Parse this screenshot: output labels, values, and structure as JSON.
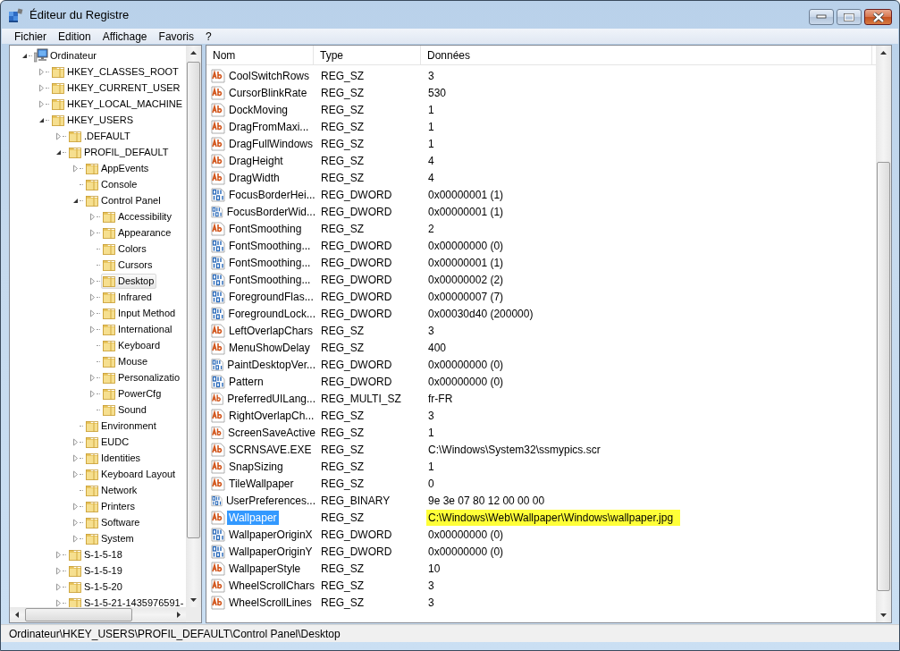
{
  "window": {
    "title": "Éditeur du Registre"
  },
  "menu": [
    "Fichier",
    "Edition",
    "Affichage",
    "Favoris",
    "?"
  ],
  "tree": {
    "label": "Ordinateur",
    "expandable": true,
    "expanded": true,
    "selected": false,
    "children": [
      {
        "label": "HKEY_CLASSES_ROOT",
        "expandable": true,
        "expanded": false,
        "selected": false
      },
      {
        "label": "HKEY_CURRENT_USER",
        "expandable": true,
        "expanded": false,
        "selected": false
      },
      {
        "label": "HKEY_LOCAL_MACHINE",
        "expandable": true,
        "expanded": false,
        "selected": false
      },
      {
        "label": "HKEY_USERS",
        "expandable": true,
        "expanded": true,
        "selected": false,
        "children": [
          {
            "label": ".DEFAULT",
            "expandable": true,
            "expanded": false,
            "selected": false
          },
          {
            "label": "PROFIL_DEFAULT",
            "expandable": true,
            "expanded": true,
            "selected": false,
            "children": [
              {
                "label": "AppEvents",
                "expandable": true,
                "expanded": false,
                "selected": false
              },
              {
                "label": "Console",
                "expandable": false,
                "selected": false
              },
              {
                "label": "Control Panel",
                "expandable": true,
                "expanded": true,
                "selected": false,
                "children": [
                  {
                    "label": "Accessibility",
                    "expandable": true,
                    "expanded": false,
                    "selected": false
                  },
                  {
                    "label": "Appearance",
                    "expandable": true,
                    "expanded": false,
                    "selected": false
                  },
                  {
                    "label": "Colors",
                    "expandable": false,
                    "selected": false
                  },
                  {
                    "label": "Cursors",
                    "expandable": false,
                    "selected": false
                  },
                  {
                    "label": "Desktop",
                    "expandable": true,
                    "expanded": false,
                    "selected": true
                  },
                  {
                    "label": "Infrared",
                    "expandable": true,
                    "expanded": false,
                    "selected": false
                  },
                  {
                    "label": "Input Method",
                    "expandable": true,
                    "expanded": false,
                    "selected": false
                  },
                  {
                    "label": "International",
                    "expandable": true,
                    "expanded": false,
                    "selected": false
                  },
                  {
                    "label": "Keyboard",
                    "expandable": false,
                    "selected": false
                  },
                  {
                    "label": "Mouse",
                    "expandable": false,
                    "selected": false
                  },
                  {
                    "label": "Personalizatio",
                    "expandable": true,
                    "expanded": false,
                    "selected": false
                  },
                  {
                    "label": "PowerCfg",
                    "expandable": true,
                    "expanded": false,
                    "selected": false
                  },
                  {
                    "label": "Sound",
                    "expandable": false,
                    "selected": false
                  }
                ]
              },
              {
                "label": "Environment",
                "expandable": false,
                "selected": false
              },
              {
                "label": "EUDC",
                "expandable": true,
                "expanded": false,
                "selected": false
              },
              {
                "label": "Identities",
                "expandable": true,
                "expanded": false,
                "selected": false
              },
              {
                "label": "Keyboard Layout",
                "expandable": true,
                "expanded": false,
                "selected": false
              },
              {
                "label": "Network",
                "expandable": false,
                "selected": false
              },
              {
                "label": "Printers",
                "expandable": true,
                "expanded": false,
                "selected": false
              },
              {
                "label": "Software",
                "expandable": true,
                "expanded": false,
                "selected": false
              },
              {
                "label": "System",
                "expandable": true,
                "expanded": false,
                "selected": false
              }
            ]
          },
          {
            "label": "S-1-5-18",
            "expandable": true,
            "expanded": false,
            "selected": false
          },
          {
            "label": "S-1-5-19",
            "expandable": true,
            "expanded": false,
            "selected": false
          },
          {
            "label": "S-1-5-20",
            "expandable": true,
            "expanded": false,
            "selected": false
          },
          {
            "label": "S-1-5-21-1435976591-",
            "expandable": true,
            "expanded": false,
            "selected": false
          }
        ]
      }
    ]
  },
  "table": {
    "columns": [
      "Nom",
      "Type",
      "Données"
    ],
    "rows": [
      {
        "kind": "string",
        "name": "CoolSwitchRows",
        "type": "REG_SZ",
        "data": "3",
        "selected": false,
        "highlighted": false
      },
      {
        "kind": "string",
        "name": "CursorBlinkRate",
        "type": "REG_SZ",
        "data": "530",
        "selected": false,
        "highlighted": false
      },
      {
        "kind": "string",
        "name": "DockMoving",
        "type": "REG_SZ",
        "data": "1",
        "selected": false,
        "highlighted": false
      },
      {
        "kind": "string",
        "name": "DragFromMaxi...",
        "type": "REG_SZ",
        "data": "1",
        "selected": false,
        "highlighted": false
      },
      {
        "kind": "string",
        "name": "DragFullWindows",
        "type": "REG_SZ",
        "data": "1",
        "selected": false,
        "highlighted": false
      },
      {
        "kind": "string",
        "name": "DragHeight",
        "type": "REG_SZ",
        "data": "4",
        "selected": false,
        "highlighted": false
      },
      {
        "kind": "string",
        "name": "DragWidth",
        "type": "REG_SZ",
        "data": "4",
        "selected": false,
        "highlighted": false
      },
      {
        "kind": "binary",
        "name": "FocusBorderHei...",
        "type": "REG_DWORD",
        "data": "0x00000001 (1)",
        "selected": false,
        "highlighted": false
      },
      {
        "kind": "binary",
        "name": "FocusBorderWid...",
        "type": "REG_DWORD",
        "data": "0x00000001 (1)",
        "selected": false,
        "highlighted": false
      },
      {
        "kind": "string",
        "name": "FontSmoothing",
        "type": "REG_SZ",
        "data": "2",
        "selected": false,
        "highlighted": false
      },
      {
        "kind": "binary",
        "name": "FontSmoothing...",
        "type": "REG_DWORD",
        "data": "0x00000000 (0)",
        "selected": false,
        "highlighted": false
      },
      {
        "kind": "binary",
        "name": "FontSmoothing...",
        "type": "REG_DWORD",
        "data": "0x00000001 (1)",
        "selected": false,
        "highlighted": false
      },
      {
        "kind": "binary",
        "name": "FontSmoothing...",
        "type": "REG_DWORD",
        "data": "0x00000002 (2)",
        "selected": false,
        "highlighted": false
      },
      {
        "kind": "binary",
        "name": "ForegroundFlas...",
        "type": "REG_DWORD",
        "data": "0x00000007 (7)",
        "selected": false,
        "highlighted": false
      },
      {
        "kind": "binary",
        "name": "ForegroundLock...",
        "type": "REG_DWORD",
        "data": "0x00030d40 (200000)",
        "selected": false,
        "highlighted": false
      },
      {
        "kind": "string",
        "name": "LeftOverlapChars",
        "type": "REG_SZ",
        "data": "3",
        "selected": false,
        "highlighted": false
      },
      {
        "kind": "string",
        "name": "MenuShowDelay",
        "type": "REG_SZ",
        "data": "400",
        "selected": false,
        "highlighted": false
      },
      {
        "kind": "binary",
        "name": "PaintDesktopVer...",
        "type": "REG_DWORD",
        "data": "0x00000000 (0)",
        "selected": false,
        "highlighted": false
      },
      {
        "kind": "binary",
        "name": "Pattern",
        "type": "REG_DWORD",
        "data": "0x00000000 (0)",
        "selected": false,
        "highlighted": false
      },
      {
        "kind": "string",
        "name": "PreferredUILang...",
        "type": "REG_MULTI_SZ",
        "data": "fr-FR",
        "selected": false,
        "highlighted": false
      },
      {
        "kind": "string",
        "name": "RightOverlapCh...",
        "type": "REG_SZ",
        "data": "3",
        "selected": false,
        "highlighted": false
      },
      {
        "kind": "string",
        "name": "ScreenSaveActive",
        "type": "REG_SZ",
        "data": "1",
        "selected": false,
        "highlighted": false
      },
      {
        "kind": "string",
        "name": "SCRNSAVE.EXE",
        "type": "REG_SZ",
        "data": "C:\\Windows\\System32\\ssmypics.scr",
        "selected": false,
        "highlighted": false
      },
      {
        "kind": "string",
        "name": "SnapSizing",
        "type": "REG_SZ",
        "data": "1",
        "selected": false,
        "highlighted": false
      },
      {
        "kind": "string",
        "name": "TileWallpaper",
        "type": "REG_SZ",
        "data": "0",
        "selected": false,
        "highlighted": false
      },
      {
        "kind": "binary",
        "name": "UserPreferences...",
        "type": "REG_BINARY",
        "data": "9e 3e 07 80 12 00 00 00",
        "selected": false,
        "highlighted": false
      },
      {
        "kind": "string",
        "name": "Wallpaper",
        "type": "REG_SZ",
        "data": "C:\\Windows\\Web\\Wallpaper\\Windows\\wallpaper.jpg",
        "selected": true,
        "highlighted": true
      },
      {
        "kind": "binary",
        "name": "WallpaperOriginX",
        "type": "REG_DWORD",
        "data": "0x00000000 (0)",
        "selected": false,
        "highlighted": false
      },
      {
        "kind": "binary",
        "name": "WallpaperOriginY",
        "type": "REG_DWORD",
        "data": "0x00000000 (0)",
        "selected": false,
        "highlighted": false
      },
      {
        "kind": "string",
        "name": "WallpaperStyle",
        "type": "REG_SZ",
        "data": "10",
        "selected": false,
        "highlighted": false
      },
      {
        "kind": "string",
        "name": "WheelScrollChars",
        "type": "REG_SZ",
        "data": "3",
        "selected": false,
        "highlighted": false
      },
      {
        "kind": "string",
        "name": "WheelScrollLines",
        "type": "REG_SZ",
        "data": "3",
        "selected": false,
        "highlighted": false
      }
    ]
  },
  "status_bar": "Ordinateur\\HKEY_USERS\\PROFIL_DEFAULT\\Control Panel\\Desktop"
}
